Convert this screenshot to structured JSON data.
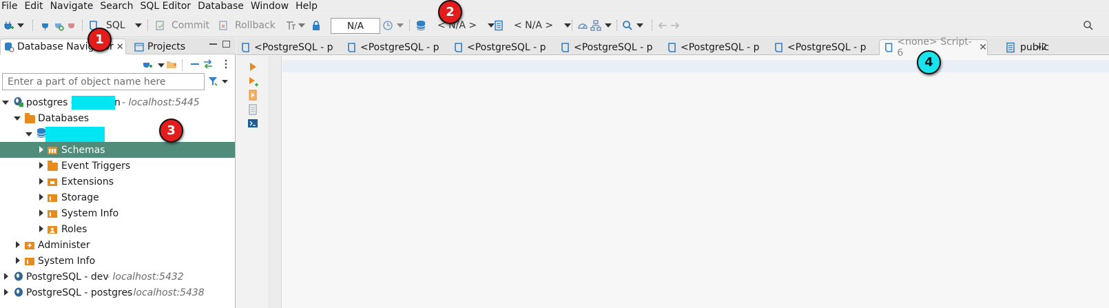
{
  "menu": [
    "File",
    "Edit",
    "Navigate",
    "Search",
    "SQL Editor",
    "Database",
    "Window",
    "Help"
  ],
  "toolbar": {
    "sql_label": "SQL",
    "commit_label": "Commit",
    "rollback_label": "Rollback",
    "na_box": "N/A",
    "datasource_label": "< N/A >",
    "schema_label": "< N/A >"
  },
  "left_panel": {
    "tab_navigator": "Database Navigator",
    "tab_projects": "Projects",
    "filter_placeholder": "Enter a part of object name here",
    "tree": [
      {
        "label": "postgres -",
        "suffix": "n",
        "host": "- localhost:5445"
      },
      {
        "label": "Databases"
      },
      {
        "label": ""
      },
      {
        "label": "Schemas"
      },
      {
        "label": "Event Triggers"
      },
      {
        "label": "Extensions"
      },
      {
        "label": "Storage"
      },
      {
        "label": "System Info"
      },
      {
        "label": "Roles"
      },
      {
        "label": "Administer"
      },
      {
        "label": "System Info"
      },
      {
        "label": "PostgreSQL - dev",
        "host": "- localhost:5432"
      },
      {
        "label": "PostgreSQL - postgres",
        "host": "- localhost:5438"
      }
    ]
  },
  "editor": {
    "tabs": [
      {
        "label": "<PostgreSQL - p"
      },
      {
        "label": "<PostgreSQL - p"
      },
      {
        "label": "<PostgreSQL - p"
      },
      {
        "label": "<PostgreSQL - p"
      },
      {
        "label": "<PostgreSQL - p"
      },
      {
        "label": "<PostgreSQL - p"
      },
      {
        "label": "<none> Script-6"
      },
      {
        "label": "public"
      }
    ],
    "more_tabs": "»2"
  },
  "callouts": [
    "1",
    "2",
    "3",
    "4"
  ],
  "colors": {
    "selection": "#518b7a",
    "folder": "#e88b1f",
    "redaction": "#00e6f2",
    "badge_red": "#e31c1c",
    "badge_cyan": "#19e3ec"
  }
}
